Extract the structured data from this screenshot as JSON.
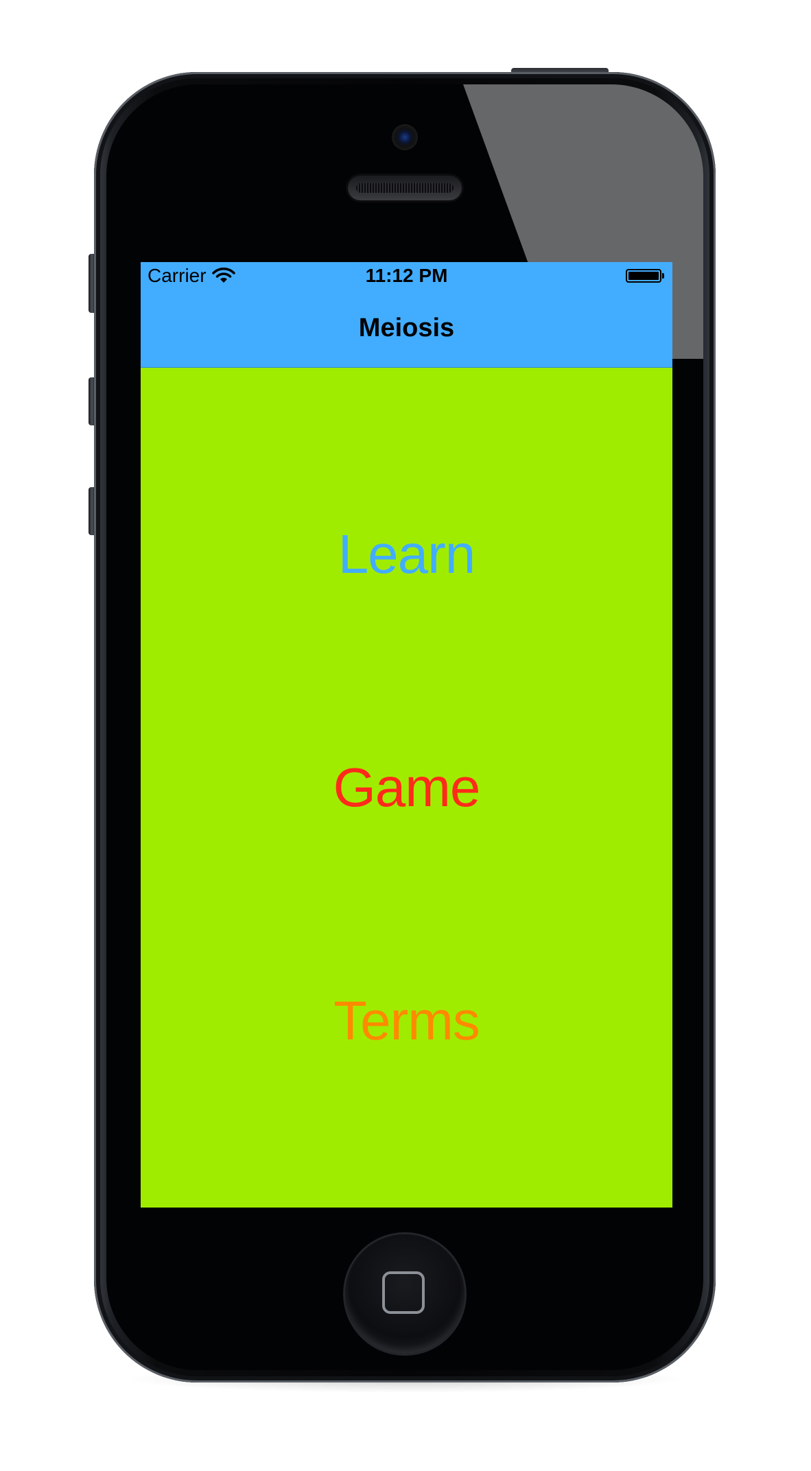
{
  "status_bar": {
    "carrier": "Carrier",
    "time": "11:12 PM"
  },
  "nav": {
    "title": "Meiosis"
  },
  "menu": {
    "learn": "Learn",
    "game": "Game",
    "terms": "Terms"
  },
  "colors": {
    "nav_background": "#42adff",
    "screen_background": "#a0ec00",
    "learn_color": "#42adff",
    "game_color": "#ff2a1a",
    "terms_color": "#ff8a00"
  },
  "icons": {
    "wifi": "wifi-icon",
    "battery": "battery-icon",
    "home": "home-button"
  }
}
